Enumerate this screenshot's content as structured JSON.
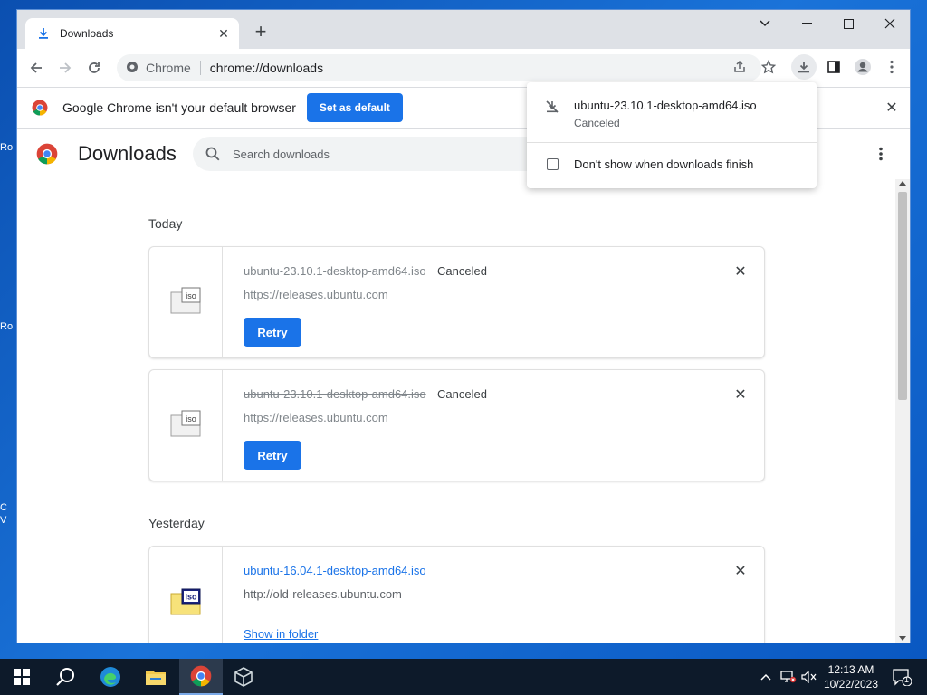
{
  "desktop": {
    "fragments": [
      "Ro",
      "Ro",
      "C",
      "V"
    ]
  },
  "tab": {
    "title": "Downloads"
  },
  "omnibox": {
    "site_label": "Chrome",
    "url": "chrome://downloads"
  },
  "infobar": {
    "message": "Google Chrome isn't your default browser",
    "button": "Set as default"
  },
  "downloads_page": {
    "title": "Downloads",
    "search_placeholder": "Search downloads",
    "sections": [
      {
        "date": "Today",
        "items": [
          {
            "filename": "ubuntu-23.10.1-desktop-amd64.iso",
            "status": "Canceled",
            "url": "https://releases.ubuntu.com",
            "action": "Retry",
            "icon_label": "iso"
          },
          {
            "filename": "ubuntu-23.10.1-desktop-amd64.iso",
            "status": "Canceled",
            "url": "https://releases.ubuntu.com",
            "action": "Retry",
            "icon_label": "iso"
          }
        ]
      },
      {
        "date": "Yesterday",
        "items": [
          {
            "filename": "ubuntu-16.04.1-desktop-amd64.iso",
            "status": "",
            "url": "http://old-releases.ubuntu.com",
            "action": "Show in folder",
            "icon_label": "iso"
          }
        ]
      }
    ]
  },
  "download_bubble": {
    "filename": "ubuntu-23.10.1-desktop-amd64.iso",
    "status": "Canceled",
    "checkbox_label": "Don't show when downloads finish"
  },
  "taskbar": {
    "time": "12:13 AM",
    "date": "10/22/2023",
    "notification_count": "1"
  },
  "colors": {
    "accent": "#1a73e8",
    "desktop": "#1a6fd4",
    "taskbar": "#0d1a2a"
  }
}
